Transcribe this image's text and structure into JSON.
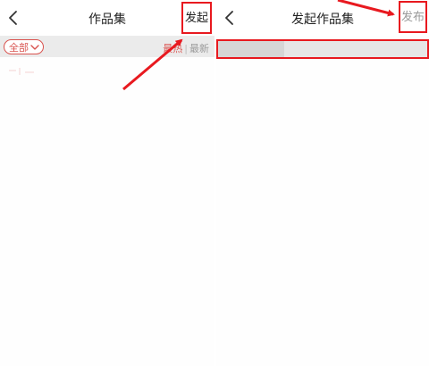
{
  "left_screen": {
    "title": "作品集",
    "action_label": "发起",
    "filter": {
      "selected": "全部"
    },
    "sort": {
      "hot": "最热",
      "separator": "|",
      "new": "最新"
    }
  },
  "right_screen": {
    "title": "发起作品集",
    "action_label": "发布"
  },
  "colors": {
    "highlight": "#e8191f",
    "accent": "#d9534f",
    "muted_text": "#9a9a9a"
  },
  "icons": [
    "back-arrow-icon",
    "chevron-down-icon",
    "annotation-arrow"
  ]
}
